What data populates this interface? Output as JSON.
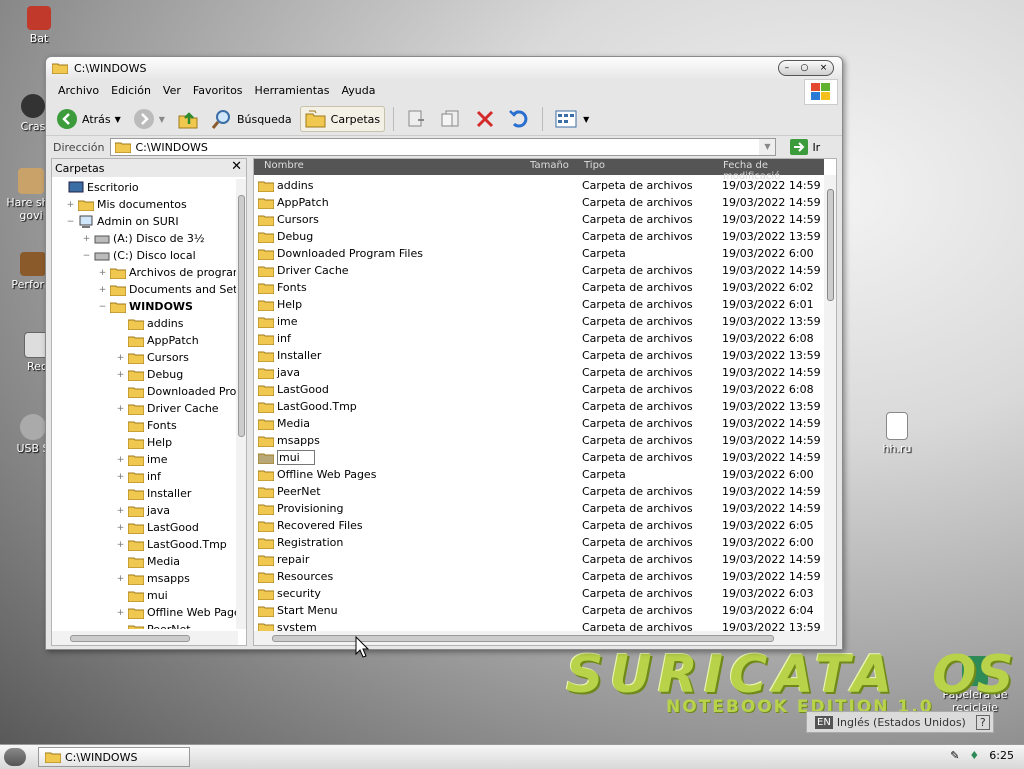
{
  "desktop": {
    "icons": [
      {
        "label": "Bat"
      },
      {
        "label": "Cras"
      },
      {
        "label": "Hare shu"
      },
      {
        "label": "govi"
      },
      {
        "label": "Perform"
      },
      {
        "label": "Rec"
      },
      {
        "label": "USB S"
      },
      {
        "label": "hh.ru"
      },
      {
        "label": "Papelera de reciclaje"
      }
    ],
    "brand_main": "SURICATA",
    "brand_os": "OS",
    "brand_sub": "NOTEBOOK EDITION 1.0",
    "language": {
      "code": "EN",
      "name": "Inglés (Estados Unidos)"
    }
  },
  "window": {
    "title": "C:\\WINDOWS",
    "menu": [
      "Archivo",
      "Edición",
      "Ver",
      "Favoritos",
      "Herramientas",
      "Ayuda"
    ],
    "toolbar": {
      "back": "Atrás",
      "search": "Búsqueda",
      "folders": "Carpetas"
    },
    "address": {
      "label": "Dirección",
      "value": "C:\\WINDOWS",
      "go": "Ir"
    },
    "folders_pane": {
      "title": "Carpetas",
      "tree": [
        {
          "label": "Escritorio",
          "level": 0,
          "expander": ""
        },
        {
          "label": "Mis documentos",
          "level": 1,
          "expander": "+"
        },
        {
          "label": "Admin on SURI",
          "level": 1,
          "expander": "−"
        },
        {
          "label": "(A:) Disco de 3½",
          "level": 2,
          "expander": "+"
        },
        {
          "label": "(C:) Disco local",
          "level": 2,
          "expander": "−"
        },
        {
          "label": "Archivos de programa",
          "level": 3,
          "expander": "+"
        },
        {
          "label": "Documents and Settin",
          "level": 3,
          "expander": "+"
        },
        {
          "label": "WINDOWS",
          "level": 3,
          "expander": "−"
        },
        {
          "label": "addins",
          "level": 4,
          "expander": ""
        },
        {
          "label": "AppPatch",
          "level": 4,
          "expander": ""
        },
        {
          "label": "Cursors",
          "level": 4,
          "expander": "+"
        },
        {
          "label": "Debug",
          "level": 4,
          "expander": "+"
        },
        {
          "label": "Downloaded Progr",
          "level": 4,
          "expander": ""
        },
        {
          "label": "Driver Cache",
          "level": 4,
          "expander": "+"
        },
        {
          "label": "Fonts",
          "level": 4,
          "expander": ""
        },
        {
          "label": "Help",
          "level": 4,
          "expander": ""
        },
        {
          "label": "ime",
          "level": 4,
          "expander": "+"
        },
        {
          "label": "inf",
          "level": 4,
          "expander": "+"
        },
        {
          "label": "Installer",
          "level": 4,
          "expander": ""
        },
        {
          "label": "java",
          "level": 4,
          "expander": "+"
        },
        {
          "label": "LastGood",
          "level": 4,
          "expander": "+"
        },
        {
          "label": "LastGood.Tmp",
          "level": 4,
          "expander": "+"
        },
        {
          "label": "Media",
          "level": 4,
          "expander": ""
        },
        {
          "label": "msapps",
          "level": 4,
          "expander": "+"
        },
        {
          "label": "mui",
          "level": 4,
          "expander": ""
        },
        {
          "label": "Offline Web Pages",
          "level": 4,
          "expander": "+"
        },
        {
          "label": "PeerNet",
          "level": 4,
          "expander": ""
        }
      ]
    },
    "list": {
      "columns": [
        "Nombre",
        "Tamaño",
        "Tipo",
        "Fecha de modificació"
      ],
      "rows": [
        {
          "name": "addins",
          "type": "Carpeta de archivos",
          "date": "19/03/2022 14:59"
        },
        {
          "name": "AppPatch",
          "type": "Carpeta de archivos",
          "date": "19/03/2022 14:59"
        },
        {
          "name": "Cursors",
          "type": "Carpeta de archivos",
          "date": "19/03/2022 14:59"
        },
        {
          "name": "Debug",
          "type": "Carpeta de archivos",
          "date": "19/03/2022 13:59"
        },
        {
          "name": "Downloaded Program Files",
          "type": "Carpeta",
          "date": "19/03/2022 6:00"
        },
        {
          "name": "Driver Cache",
          "type": "Carpeta de archivos",
          "date": "19/03/2022 14:59"
        },
        {
          "name": "Fonts",
          "type": "Carpeta de archivos",
          "date": "19/03/2022 6:02"
        },
        {
          "name": "Help",
          "type": "Carpeta de archivos",
          "date": "19/03/2022 6:01"
        },
        {
          "name": "ime",
          "type": "Carpeta de archivos",
          "date": "19/03/2022 13:59"
        },
        {
          "name": "inf",
          "type": "Carpeta de archivos",
          "date": "19/03/2022 6:08"
        },
        {
          "name": "Installer",
          "type": "Carpeta de archivos",
          "date": "19/03/2022 13:59"
        },
        {
          "name": "java",
          "type": "Carpeta de archivos",
          "date": "19/03/2022 14:59"
        },
        {
          "name": "LastGood",
          "type": "Carpeta de archivos",
          "date": "19/03/2022 6:08"
        },
        {
          "name": "LastGood.Tmp",
          "type": "Carpeta de archivos",
          "date": "19/03/2022 13:59"
        },
        {
          "name": "Media",
          "type": "Carpeta de archivos",
          "date": "19/03/2022 14:59"
        },
        {
          "name": "msapps",
          "type": "Carpeta de archivos",
          "date": "19/03/2022 14:59"
        },
        {
          "name": "mui",
          "type": "Carpeta de archivos",
          "date": "19/03/2022 14:59"
        },
        {
          "name": "Offline Web Pages",
          "type": "Carpeta",
          "date": "19/03/2022 6:00"
        },
        {
          "name": "PeerNet",
          "type": "Carpeta de archivos",
          "date": "19/03/2022 14:59"
        },
        {
          "name": "Provisioning",
          "type": "Carpeta de archivos",
          "date": "19/03/2022 14:59"
        },
        {
          "name": "Recovered Files",
          "type": "Carpeta de archivos",
          "date": "19/03/2022 6:05"
        },
        {
          "name": "Registration",
          "type": "Carpeta de archivos",
          "date": "19/03/2022 6:00"
        },
        {
          "name": "repair",
          "type": "Carpeta de archivos",
          "date": "19/03/2022 14:59"
        },
        {
          "name": "Resources",
          "type": "Carpeta de archivos",
          "date": "19/03/2022 14:59"
        },
        {
          "name": "security",
          "type": "Carpeta de archivos",
          "date": "19/03/2022 6:03"
        },
        {
          "name": "Start Menu",
          "type": "Carpeta de archivos",
          "date": "19/03/2022 6:04"
        },
        {
          "name": "system",
          "type": "Carpeta de archivos",
          "date": "19/03/2022 13:59"
        }
      ]
    }
  },
  "taskbar": {
    "window_button": "C:\\WINDOWS",
    "clock": "6:25"
  },
  "colors": {
    "folder": "#f0c850",
    "brand": "#b8d34a",
    "header": "#555555"
  }
}
